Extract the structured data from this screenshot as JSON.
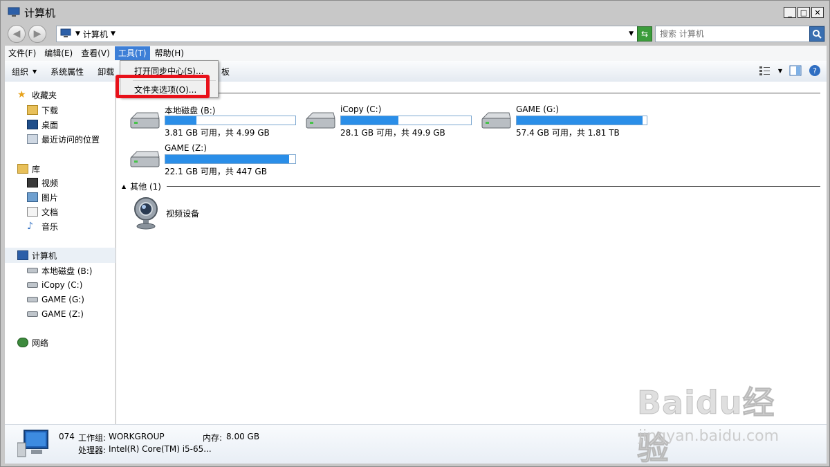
{
  "window": {
    "title": "计算机"
  },
  "address": {
    "path": "计算机"
  },
  "search": {
    "placeholder": "搜索 计算机"
  },
  "menubar": {
    "items": [
      "文件(F)",
      "编辑(E)",
      "查看(V)",
      "工具(T)",
      "帮助(H)"
    ]
  },
  "toolbar": {
    "organize": "组织",
    "system_props": "系统属性",
    "uninstall_partial": "卸载",
    "control_panel_partial": "板"
  },
  "tools_menu": {
    "items": [
      "打开同步中心(S)...",
      "文件夹选项(O)..."
    ]
  },
  "sidebar": {
    "favorites": "收藏夹",
    "favorites_items": [
      "下载",
      "桌面",
      "最近访问的位置"
    ],
    "libraries": "库",
    "libraries_items": [
      "视频",
      "图片",
      "文档",
      "音乐"
    ],
    "computer": "计算机",
    "computer_items": [
      "本地磁盘 (B:)",
      "iCopy (C:)",
      "GAME (G:)",
      "GAME (Z:)"
    ],
    "network": "网络"
  },
  "drives": [
    {
      "name": "本地磁盘 (B:)",
      "info": "3.81 GB 可用，共 4.99 GB",
      "used_fraction": 0.24
    },
    {
      "name": "iCopy (C:)",
      "info": "28.1 GB 可用，共 49.9 GB",
      "used_fraction": 0.44
    },
    {
      "name": "GAME (G:)",
      "info": "57.4 GB 可用，共 1.81 TB",
      "used_fraction": 0.97
    },
    {
      "name": "GAME (Z:)",
      "info": "22.1 GB 可用，共 447 GB",
      "used_fraction": 0.95
    }
  ],
  "other_section": {
    "header": "其他 (1)",
    "item": "视频设备"
  },
  "status": {
    "name": "074",
    "workgroup_label": "工作组:",
    "workgroup": "WORKGROUP",
    "memory_label": "内存:",
    "memory": "8.00 GB",
    "cpu_label": "处理器:",
    "cpu": "Intel(R) Core(TM) i5-65..."
  },
  "watermark": {
    "logo": "Baidu经验",
    "url": "jingyan.baidu.com"
  },
  "colors": {
    "accent": "#3d7fd7",
    "bar_fill": "#2a8ee8",
    "highlight": "#e8111a"
  }
}
